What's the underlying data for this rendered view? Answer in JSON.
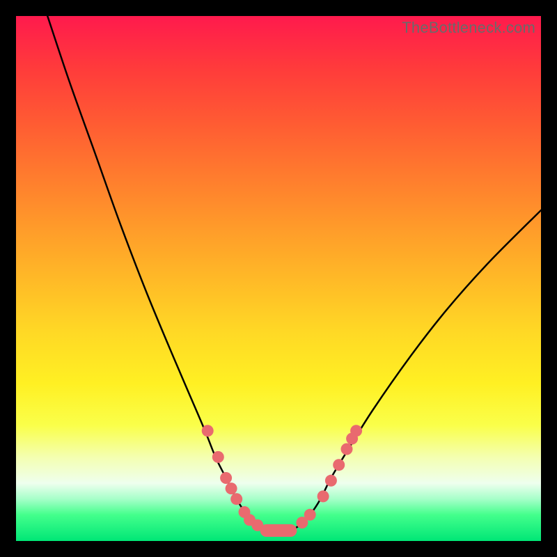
{
  "watermark": "TheBottleneck.com",
  "chart_data": {
    "type": "line",
    "title": "",
    "xlabel": "",
    "ylabel": "",
    "xlim": [
      0,
      100
    ],
    "ylim": [
      0,
      100
    ],
    "grid": false,
    "series": [
      {
        "name": "bottleneck-curve",
        "x": [
          6,
          10,
          15,
          20,
          25,
          30,
          33,
          36,
          38,
          40,
          42,
          44,
          46,
          48,
          52,
          54,
          56,
          58,
          60,
          63,
          68,
          75,
          82,
          90,
          100
        ],
        "y": [
          100,
          88,
          74,
          60,
          47,
          35,
          28,
          21,
          16,
          12,
          8,
          5,
          3,
          2,
          2,
          3,
          5,
          8,
          12,
          17,
          25,
          35,
          44,
          53,
          63
        ]
      }
    ],
    "markers": {
      "name": "highlight-dots",
      "color": "#e96a6f",
      "points": [
        {
          "x": 36.5,
          "y": 21
        },
        {
          "x": 38.5,
          "y": 16
        },
        {
          "x": 40.0,
          "y": 12
        },
        {
          "x": 41.0,
          "y": 10
        },
        {
          "x": 42.0,
          "y": 8
        },
        {
          "x": 43.5,
          "y": 5.5
        },
        {
          "x": 44.5,
          "y": 4
        },
        {
          "x": 46.0,
          "y": 3
        },
        {
          "x": 54.5,
          "y": 3.5
        },
        {
          "x": 56.0,
          "y": 5
        },
        {
          "x": 58.5,
          "y": 8.5
        },
        {
          "x": 60.0,
          "y": 11.5
        },
        {
          "x": 61.5,
          "y": 14.5
        },
        {
          "x": 63.0,
          "y": 17.5
        },
        {
          "x": 64.0,
          "y": 19.5
        },
        {
          "x": 64.8,
          "y": 21
        }
      ],
      "bottom_bar": {
        "x0": 46.5,
        "x1": 53.5,
        "y": 2,
        "thickness": 2.4
      }
    },
    "gradient_stops": [
      {
        "pos": 0,
        "color": "#ff1a4d"
      },
      {
        "pos": 50,
        "color": "#ffb927"
      },
      {
        "pos": 78,
        "color": "#faff4a"
      },
      {
        "pos": 100,
        "color": "#00e676"
      }
    ]
  }
}
